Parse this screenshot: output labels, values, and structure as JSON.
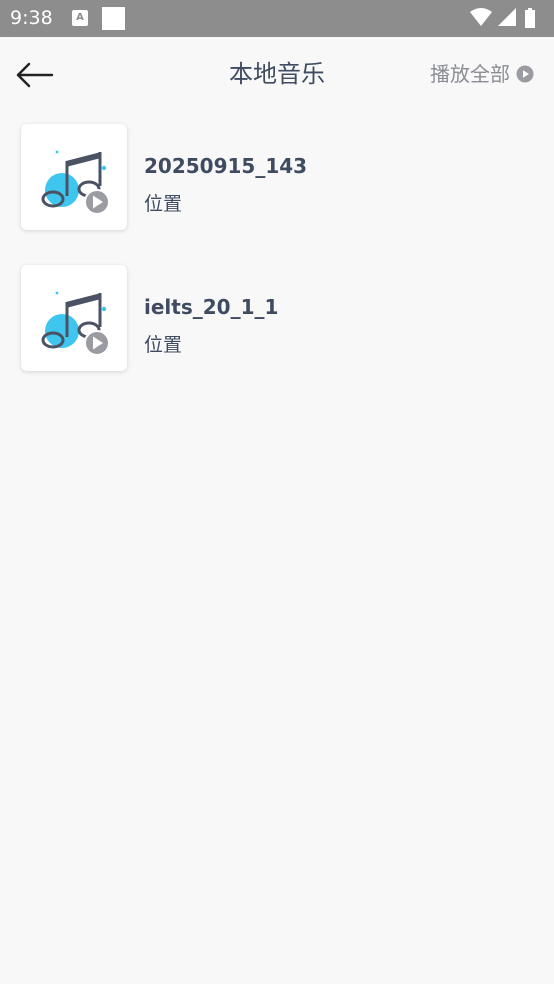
{
  "status_bar": {
    "time": "9:38",
    "a_icon_letter": "A"
  },
  "header": {
    "title": "本地音乐",
    "play_all_label": "播放全部"
  },
  "songs": [
    {
      "title": "20250915_143",
      "subtitle": "位置"
    },
    {
      "title": "ielts_20_1_1",
      "subtitle": "位置"
    }
  ],
  "colors": {
    "status_bar": "#8d8d8d",
    "background": "#f8f8f9",
    "title_text": "#3f4b60",
    "secondary_text": "#8a8d93",
    "accent_blue": "#3ec6ee"
  }
}
